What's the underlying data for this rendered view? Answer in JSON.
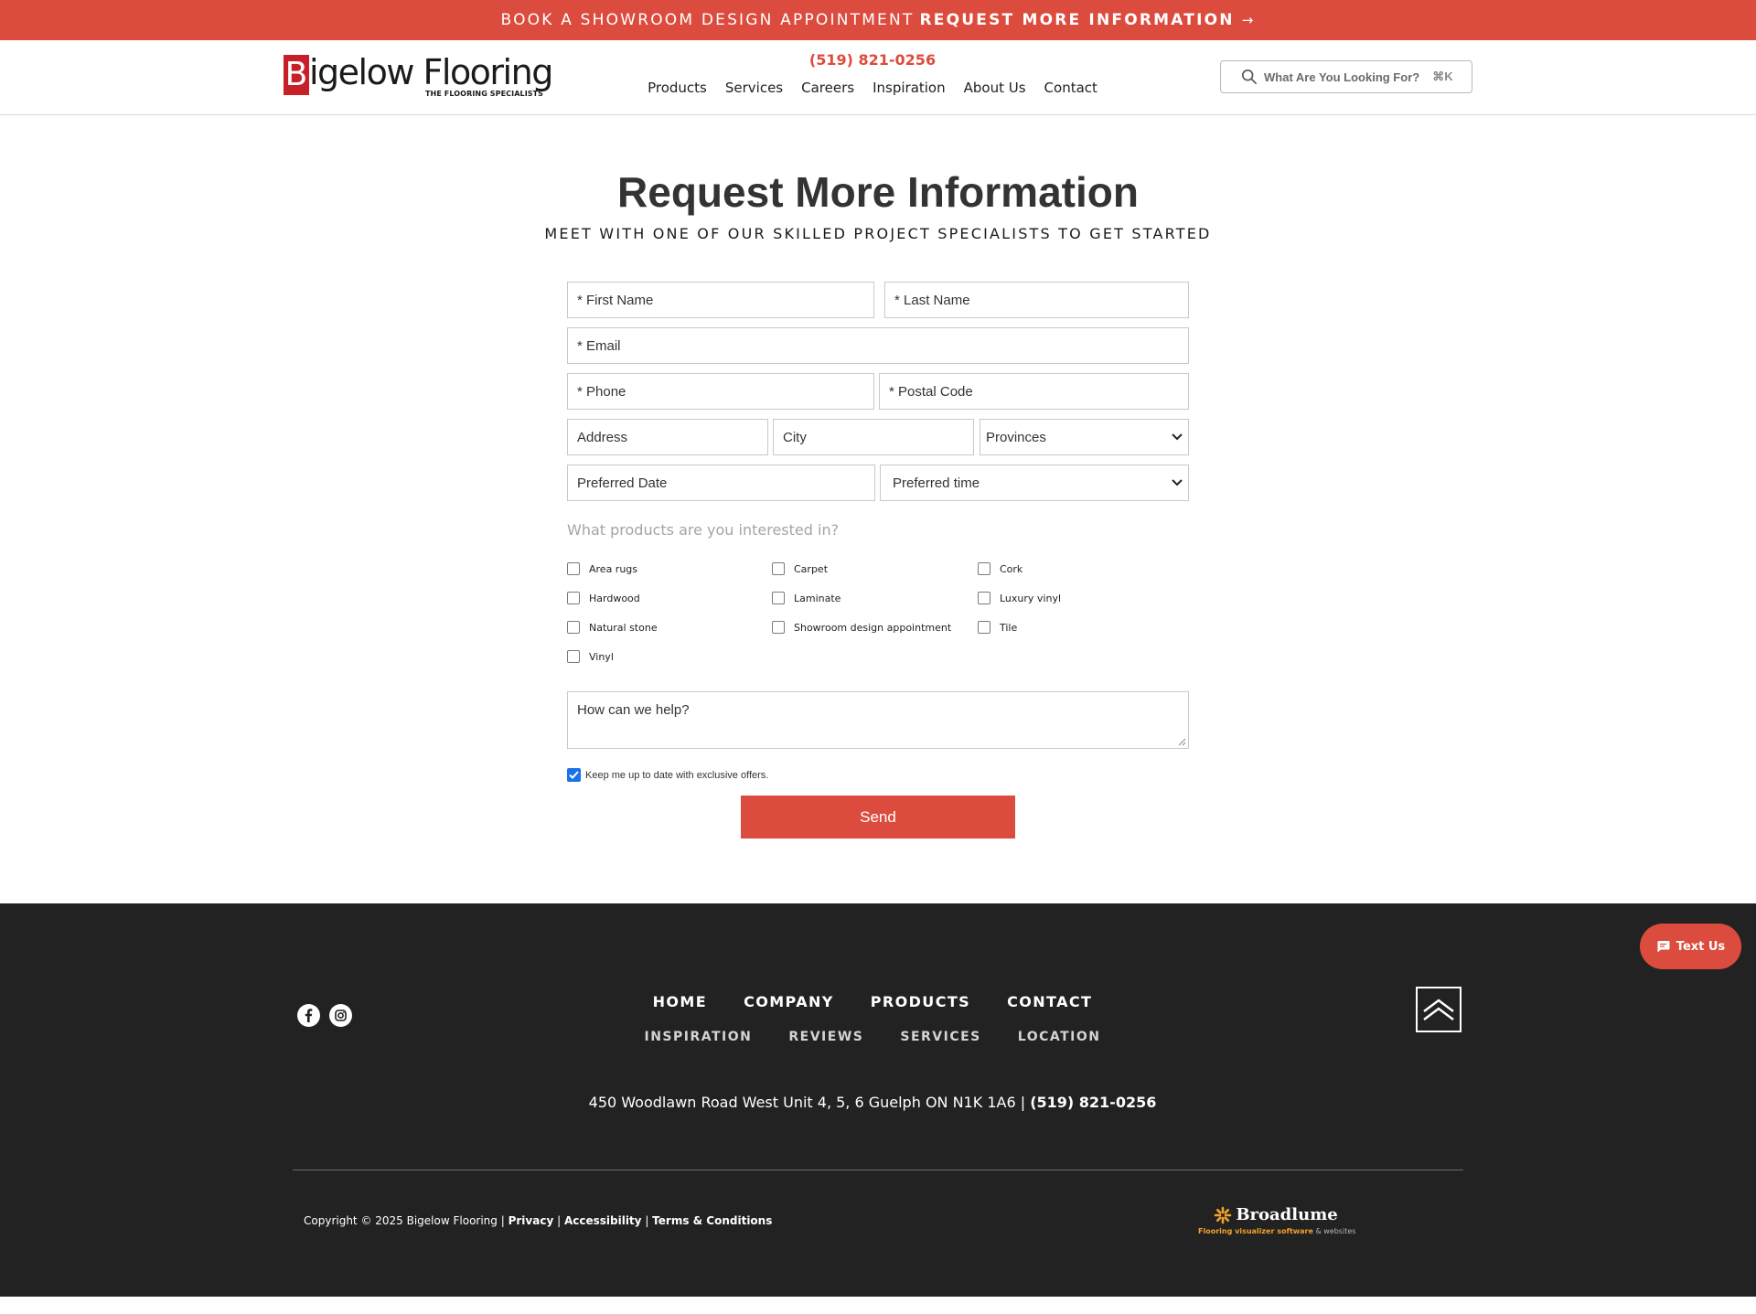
{
  "banner": {
    "lead": "BOOK A SHOWROOM DESIGN APPOINTMENT",
    "cta": "REQUEST MORE INFORMATION",
    "arrow": "→"
  },
  "header": {
    "logo_initial": "B",
    "logo_word": "igelow Flooring",
    "logo_tagline": "THE FLOORING SPECIALISTS",
    "phone": "(519) 821-0256",
    "nav": [
      "Products",
      "Services",
      "Careers",
      "Inspiration",
      "About Us",
      "Contact"
    ],
    "search": {
      "placeholder": "What Are You Looking For?",
      "shortcut": "⌘K",
      "icon": "search-icon"
    }
  },
  "form": {
    "title": "Request More Information",
    "subtitle": "MEET WITH ONE OF OUR SKILLED PROJECT SPECIALISTS TO GET STARTED",
    "fields": {
      "first_name": "* First Name",
      "last_name": "* Last Name",
      "email": "* Email",
      "phone": "* Phone",
      "postal_code": "* Postal Code",
      "address": "Address",
      "city": "City",
      "provinces": "Provinces",
      "preferred_date": "Preferred Date",
      "preferred_time": "Preferred time"
    },
    "products_question": "What products are you interested in?",
    "products": [
      "Area rugs",
      "Carpet",
      "Cork",
      "Hardwood",
      "Laminate",
      "Luxury vinyl",
      "Natural stone",
      "Showroom design appointment",
      "Tile",
      "Vinyl"
    ],
    "message_placeholder": "How can we help?",
    "optin_label": "Keep me up to date with exclusive offers.",
    "optin_checked": true,
    "send_label": "Send"
  },
  "footer": {
    "nav_primary": [
      "HOME",
      "COMPANY",
      "PRODUCTS",
      "CONTACT"
    ],
    "nav_secondary": [
      "INSPIRATION",
      "REVIEWS",
      "SERVICES",
      "LOCATION"
    ],
    "address": "450 Woodlawn Road West Unit 4, 5, 6 Guelph ON N1K 1A6 |",
    "phone": "(519) 821-0256",
    "copyright": "Copyright © 2025 Bigelow Flooring |",
    "links": [
      "Privacy",
      "Accessibility",
      "Terms & Conditions"
    ],
    "brand_name": "Broadlume",
    "brand_tag": "Flooring visualizer software",
    "brand_tag_suffix": "& websites",
    "social": [
      "facebook-icon",
      "instagram-icon"
    ]
  },
  "chat": {
    "label": "Text Us"
  },
  "colors": {
    "accent": "#dc4c3e",
    "footer_bg": "#222222",
    "logo_red": "#c82028",
    "brand_orange": "#f2a22a"
  }
}
